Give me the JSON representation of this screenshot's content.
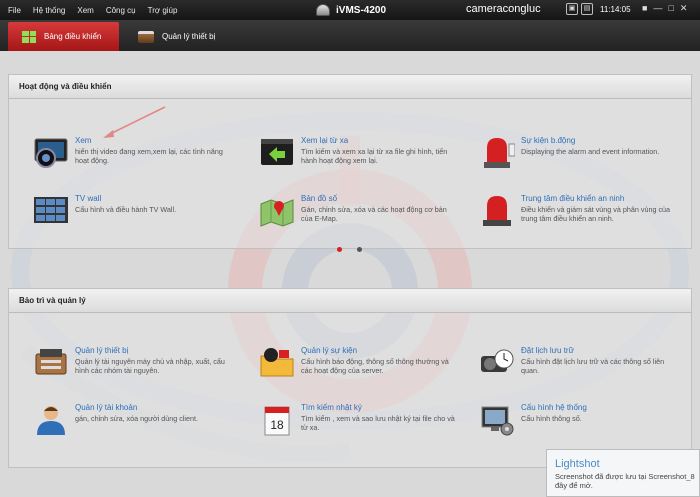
{
  "menubar": {
    "items": [
      "File",
      "Hệ thống",
      "Xem",
      "Công cụ",
      "Trợ giúp"
    ],
    "app_title": "iVMS-4200",
    "user_name": "cameracongluc",
    "clock": "11:14:05"
  },
  "tabs": [
    {
      "label": "Bảng điều khiển",
      "active": true
    },
    {
      "label": "Quản lý thiết bị",
      "active": false
    }
  ],
  "sections": {
    "operation": {
      "title": "Hoạt động và điều khiển",
      "items": [
        {
          "title": "Xem",
          "desc": "hiển thị video đang xem,xem lại, các tình năng hoạt động.",
          "icon": "live-view-icon"
        },
        {
          "title": "Xem lại từ xa",
          "desc": "Tìm kiếm và xem xa lại từ xa file ghi hình, tiến hành hoạt động xem lại.",
          "icon": "remote-playback-icon"
        },
        {
          "title": "Sự kiện b.động",
          "desc": "Displaying the alarm and event information.",
          "icon": "alarm-event-icon"
        },
        {
          "title": "TV wall",
          "desc": "Cấu hình và điều hành TV Wall.",
          "icon": "tv-wall-icon"
        },
        {
          "title": "Bản đồ số",
          "desc": "Gán, chỉnh sửa, xóa và các hoạt động cơ bản của E-Map.",
          "icon": "emap-icon"
        },
        {
          "title": "Trung tâm điều khiển an ninh",
          "desc": "Điều khiển và giám sát vùng và phân vùng của trung tâm điều khiển an ninh.",
          "icon": "security-center-icon"
        }
      ]
    },
    "maintenance": {
      "title": "Bảo trì và quản lý",
      "items": [
        {
          "title": "Quản lý thiết bị",
          "desc": "Quản lý tài nguyên máy chủ và nhập, xuất, cấu hình các nhóm tài nguyên.",
          "icon": "device-management-icon"
        },
        {
          "title": "Quản lý sự kiện",
          "desc": "Cấu hình báo động, thông số thông thường và các hoạt động của server.",
          "icon": "event-management-icon"
        },
        {
          "title": "Đặt lịch lưu trữ",
          "desc": "Cấu hình đặt lịch lưu trữ và các thông số liên quan.",
          "icon": "storage-schedule-icon"
        },
        {
          "title": "Quản lý tài khoản",
          "desc": "gán, chỉnh sửa, xóa người dùng client.",
          "icon": "account-management-icon"
        },
        {
          "title": "Tìm kiếm nhật ký",
          "desc": "Tìm kiếm , xem và sao lưu nhật ký tại file cho và từ xa.",
          "icon": "log-search-icon"
        },
        {
          "title": "Cấu hình hệ thống",
          "desc": "Cấu hình thông số.",
          "icon": "system-config-icon"
        }
      ]
    }
  },
  "pager": {
    "pages": 2,
    "current": 1
  },
  "lightshot": {
    "title": "Lightshot",
    "text": "Screenshot đã được lưu tại Screenshot_8 đây để mở."
  },
  "colors": {
    "accent_red": "#c62828",
    "link_blue": "#2e6fb8"
  }
}
